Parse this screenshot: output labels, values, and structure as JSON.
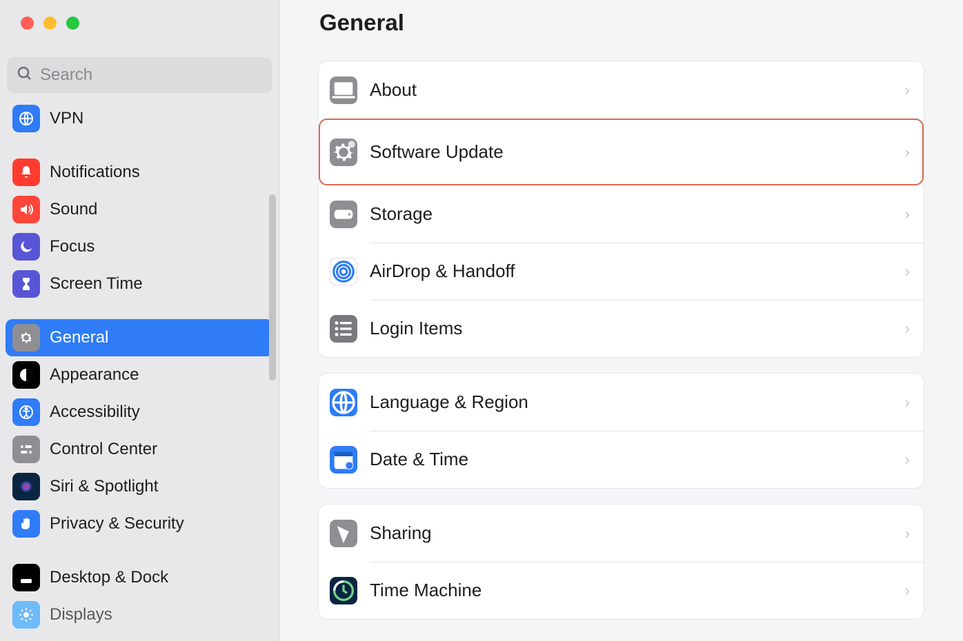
{
  "window": {
    "search_placeholder": "Search"
  },
  "sidebar": {
    "groups": [
      {
        "items": [
          {
            "label": "VPN",
            "icon": "vpn-globe-icon",
            "bg": "bg-blue"
          }
        ]
      },
      {
        "items": [
          {
            "label": "Notifications",
            "icon": "bell-icon",
            "bg": "bg-red"
          },
          {
            "label": "Sound",
            "icon": "speaker-icon",
            "bg": "bg-red2"
          },
          {
            "label": "Focus",
            "icon": "moon-icon",
            "bg": "bg-purple"
          },
          {
            "label": "Screen Time",
            "icon": "hourglass-icon",
            "bg": "bg-purple"
          }
        ]
      },
      {
        "items": [
          {
            "label": "General",
            "icon": "gear-icon",
            "bg": "bg-gray",
            "selected": true
          },
          {
            "label": "Appearance",
            "icon": "contrast-icon",
            "bg": "bg-black"
          },
          {
            "label": "Accessibility",
            "icon": "accessibility-icon",
            "bg": "bg-blue"
          },
          {
            "label": "Control Center",
            "icon": "sliders-icon",
            "bg": "bg-gray"
          },
          {
            "label": "Siri & Spotlight",
            "icon": "siri-icon",
            "bg": "bg-darkblue"
          },
          {
            "label": "Privacy & Security",
            "icon": "hand-icon",
            "bg": "bg-blue"
          }
        ]
      },
      {
        "items": [
          {
            "label": "Desktop & Dock",
            "icon": "dock-icon",
            "bg": "bg-black"
          },
          {
            "label": "Displays",
            "icon": "sun-icon",
            "bg": "bg-cyan"
          }
        ]
      }
    ]
  },
  "main": {
    "title": "General",
    "panels": [
      {
        "rows": [
          {
            "label": "About",
            "icon": "laptop-icon",
            "bg": "bg-gray"
          },
          {
            "label": "Software Update",
            "icon": "gear-badge-icon",
            "bg": "bg-gray",
            "highlighted": true
          },
          {
            "label": "Storage",
            "icon": "disk-icon",
            "bg": "bg-gray"
          },
          {
            "label": "AirDrop & Handoff",
            "icon": "airdrop-icon",
            "bg": "bg-white-b"
          },
          {
            "label": "Login Items",
            "icon": "list-icon",
            "bg": "bg-gray-dark"
          }
        ]
      },
      {
        "rows": [
          {
            "label": "Language & Region",
            "icon": "globe-icon",
            "bg": "bg-blue"
          },
          {
            "label": "Date & Time",
            "icon": "calendar-icon",
            "bg": "bg-blue"
          }
        ]
      },
      {
        "rows": [
          {
            "label": "Sharing",
            "icon": "sharing-icon",
            "bg": "bg-gray"
          },
          {
            "label": "Time Machine",
            "icon": "timemachine-icon",
            "bg": "bg-darkblue"
          }
        ]
      }
    ]
  }
}
